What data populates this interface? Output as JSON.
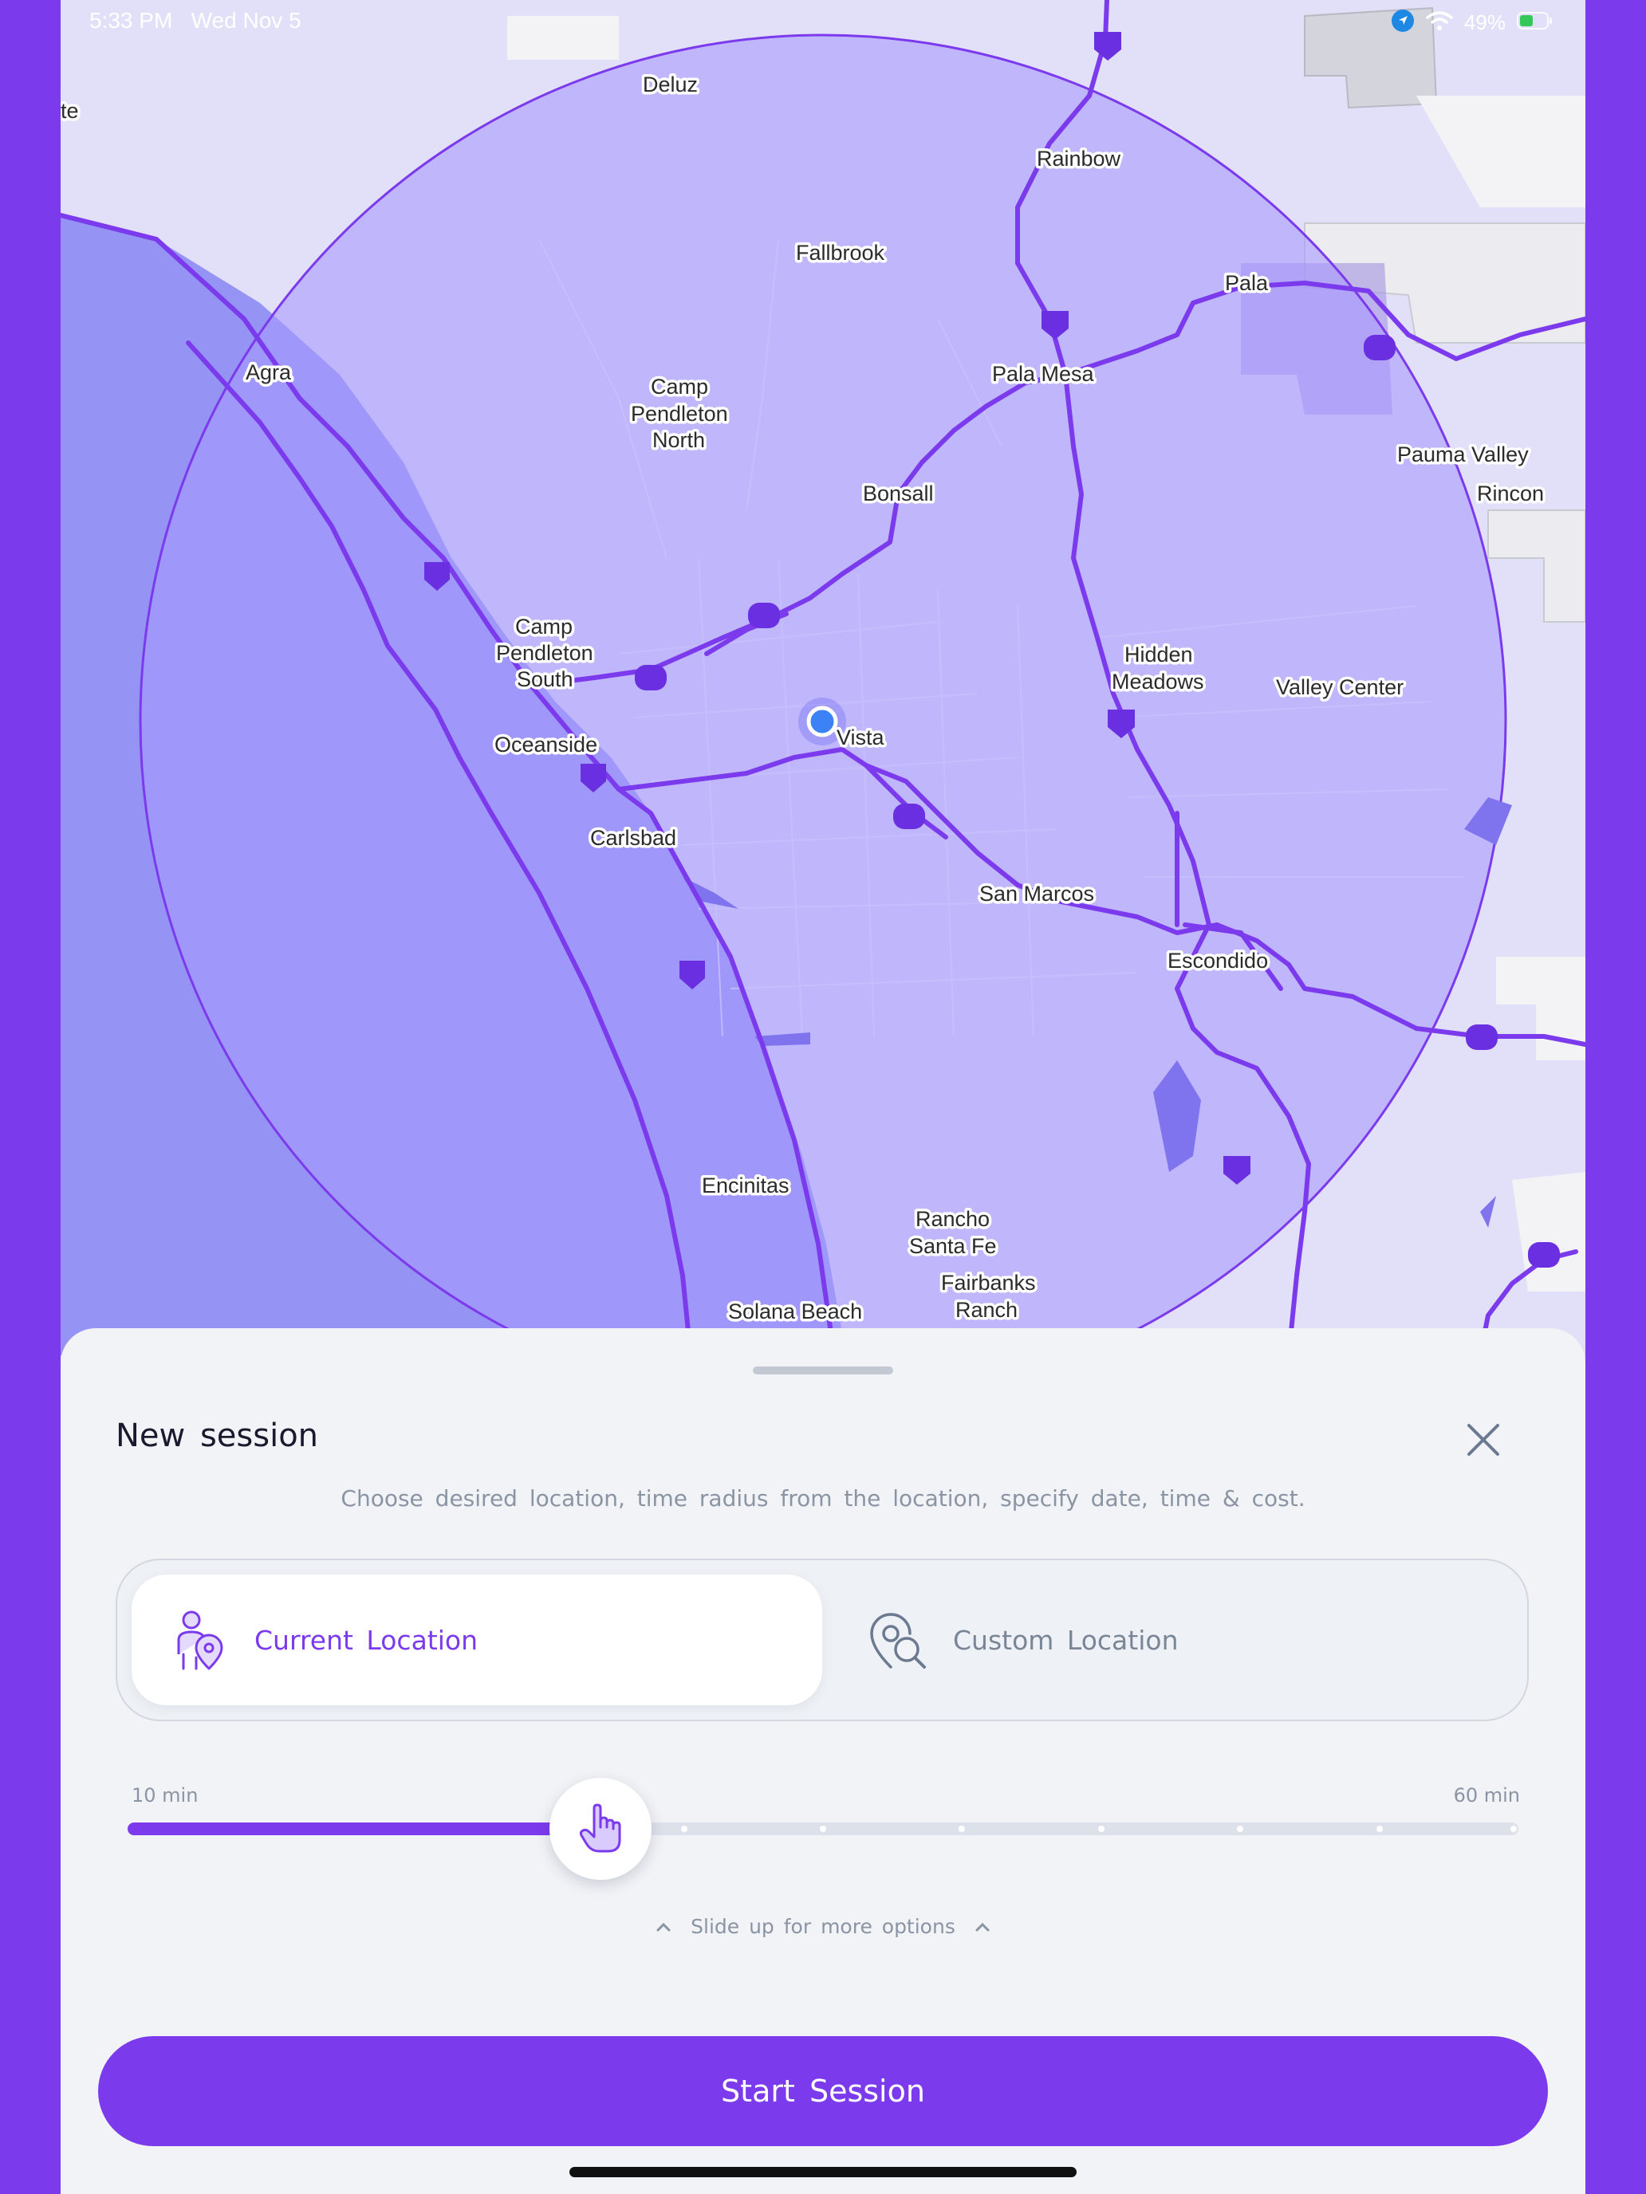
{
  "status_bar": {
    "time": "5:33 PM",
    "date": "Wed Nov 5",
    "battery": "49%",
    "icons": [
      "location-arrow-icon",
      "wifi-icon",
      "battery-icon"
    ]
  },
  "map": {
    "radius_color": "#a99aff",
    "road_color": "#7c3aed",
    "labels": {
      "deluz": "Deluz",
      "rainbow": "Rainbow",
      "fallbrook": "Fallbrook",
      "pala": "Pala",
      "agra": "Agra",
      "camp_north_1": "Camp",
      "camp_north_2": "Pendleton",
      "camp_north_3": "North",
      "pala_mesa": "Pala Mesa",
      "pauma_valley": "Pauma Valley",
      "rincon": "Rincon",
      "bonsall": "Bonsall",
      "camp_south_1": "Camp",
      "camp_south_2": "Pendleton",
      "camp_south_3": "South",
      "hidden_1": "Hidden",
      "hidden_2": "Meadows",
      "valley_center": "Valley Center",
      "oceanside": "Oceanside",
      "vista": "Vista",
      "carlsbad": "Carlsbad",
      "san_marcos": "San Marcos",
      "escondido": "Escondido",
      "encinitas": "Encinitas",
      "rancho_1": "Rancho",
      "rancho_2": "Santa Fe",
      "fairbanks_1": "Fairbanks",
      "fairbanks_2": "Ranch",
      "solana_beach": "Solana Beach",
      "edge_te": "te"
    }
  },
  "sheet": {
    "title": "New session",
    "subtitle": "Choose desired location, time radius from the location, specify date, time & cost.",
    "location_options": [
      {
        "label": "Current Location",
        "icon": "person-location-pin-icon",
        "selected": true
      },
      {
        "label": "Custom Location",
        "icon": "location-search-icon",
        "selected": false
      }
    ],
    "slider": {
      "min_label": "10 min",
      "max_label": "60 min",
      "min": 10,
      "max": 60,
      "value": 27,
      "thumb_icon": "pointing-hand-icon"
    },
    "more_options": "Slide up for more options",
    "start_button": "Start Session",
    "accent": "#7c3aed"
  }
}
